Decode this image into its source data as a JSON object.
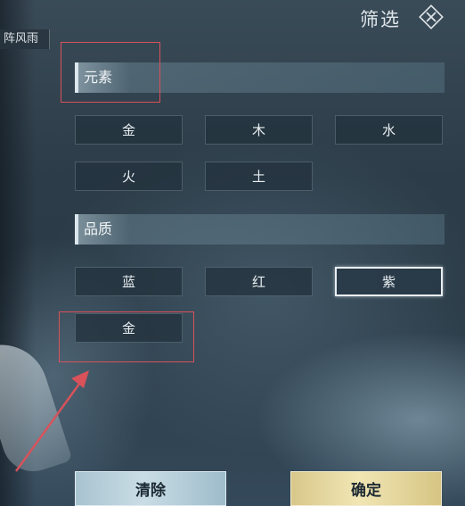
{
  "top_tab": {
    "label": "阵风雨"
  },
  "header": {
    "title": "筛选",
    "close_icon": "close-x-icon"
  },
  "sections": {
    "element": {
      "title": "元素",
      "options": [
        "金",
        "木",
        "水",
        "火",
        "土"
      ]
    },
    "quality": {
      "title": "品质",
      "options": [
        "蓝",
        "红",
        "紫",
        "金"
      ],
      "selected": "紫"
    }
  },
  "footer": {
    "clear_label": "清除",
    "confirm_label": "确定"
  },
  "colors": {
    "annotation_red": "#d9525a",
    "confirm_gold": "#f1e6b4",
    "clear_blue": "#c9dde5"
  }
}
